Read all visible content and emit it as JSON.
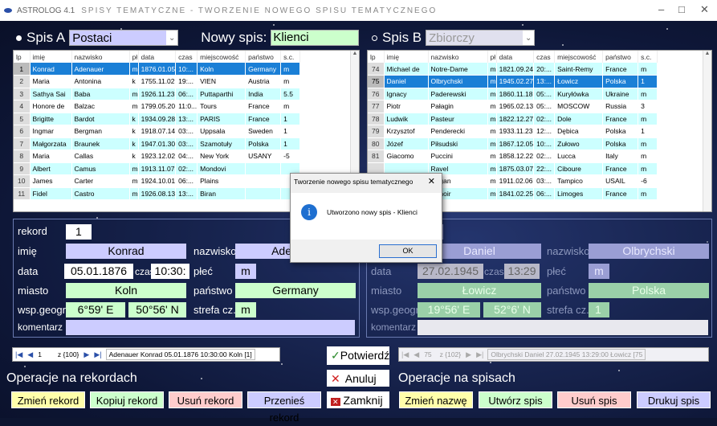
{
  "window": {
    "app": "ASTROLOG 4.1",
    "title": "SPISY TEMATYCZNE - TWORZENIE NOWEGO SPISU TEMATYCZNEGO",
    "minimize": "–",
    "maximize": "□",
    "close": "✕"
  },
  "listA": {
    "label": "Spis A",
    "value": "Postaci",
    "new_label": "Nowy spis:",
    "new_value": "Klienci"
  },
  "listB": {
    "label": "Spis B",
    "value": "Zbiorczy"
  },
  "columns": [
    "lp",
    "imię",
    "nazwisko",
    "pł",
    "data",
    "czas",
    "miejscowość",
    "państwo",
    "s.c."
  ],
  "gridA": [
    [
      "1",
      "Konrad",
      "Adenauer",
      "m",
      "1876.01.05",
      "10:...",
      "Koln",
      "Germany",
      "m"
    ],
    [
      "2",
      "Maria",
      "Antonina",
      "k",
      "1755.11.02",
      "19:...",
      "VIEN",
      "Austria",
      "m"
    ],
    [
      "3",
      "Sathya Sai",
      "Baba",
      "m",
      "1926.11.23",
      "06:...",
      "Puttaparthi",
      "India",
      "5.5"
    ],
    [
      "4",
      "Honore de",
      "Balzac",
      "m",
      "1799.05.20",
      "11:0...",
      "Tours",
      "France",
      "m"
    ],
    [
      "5",
      "Brigitte",
      "Bardot",
      "k",
      "1934.09.28",
      "13:...",
      "PARIS",
      "France",
      "1"
    ],
    [
      "6",
      "Ingmar",
      "Bergman",
      "k",
      "1918.07.14",
      "03:...",
      "Uppsala",
      "Sweden",
      "1"
    ],
    [
      "7",
      "Małgorzata",
      "Braunek",
      "k",
      "1947.01.30",
      "03:...",
      "Szamotuły",
      "Polska",
      "1"
    ],
    [
      "8",
      "Maria",
      "Callas",
      "k",
      "1923.12.02",
      "04:...",
      "New York",
      "USANY",
      "-5"
    ],
    [
      "9",
      "Albert",
      "Camus",
      "m",
      "1913.11.07",
      "02:...",
      "Mondovi",
      "",
      ""
    ],
    [
      "10",
      "James",
      "Carter",
      "m",
      "1924.10.01",
      "06:...",
      "Plains",
      "",
      ""
    ],
    [
      "11",
      "Fidel",
      "Castro",
      "m",
      "1926.08.13",
      "13:...",
      "Biran",
      "",
      ""
    ]
  ],
  "gridB": [
    [
      "74",
      "Michael de",
      "Notre-Dame",
      "m",
      "1821.09.24",
      "20:...",
      "Saint-Remy",
      "France",
      "m"
    ],
    [
      "75",
      "Daniel",
      "Olbrychski",
      "m",
      "1945.02.27",
      "13:...",
      "Łowicz",
      "Polska",
      "1"
    ],
    [
      "76",
      "Ignacy",
      "Paderewski",
      "m",
      "1860.11.18",
      "05:...",
      "Kuryłówka",
      "Ukraine",
      "m"
    ],
    [
      "77",
      "Piotr",
      "Pałagin",
      "m",
      "1965.02.13",
      "05:...",
      "MOSCOW",
      "Russia",
      "3"
    ],
    [
      "78",
      "Ludwik",
      "Pasteur",
      "m",
      "1822.12.27",
      "02:...",
      "Dole",
      "France",
      "m"
    ],
    [
      "79",
      "Krzysztof",
      "Penderecki",
      "m",
      "1933.11.23",
      "12:...",
      "Dębica",
      "Polska",
      "1"
    ],
    [
      "80",
      "Józef",
      "Piłsudski",
      "m",
      "1867.12.05",
      "10:...",
      "Zułowo",
      "Polska",
      "m"
    ],
    [
      "81",
      "Giacomo",
      "Puccini",
      "m",
      "1858.12.22",
      "02:...",
      "Lucca",
      "Italy",
      "m"
    ],
    [
      "",
      "",
      "Ravel",
      "m",
      "1875.03.07",
      "22:...",
      "Ciboure",
      "France",
      "m"
    ],
    [
      "",
      "",
      "Regan",
      "m",
      "1911.02.06",
      "03:...",
      "Tampico",
      "USAIL",
      "-6"
    ],
    [
      "",
      "",
      "Renoir",
      "m",
      "1841.02.25",
      "06:...",
      "Limoges",
      "France",
      "m"
    ]
  ],
  "recA": {
    "l_rekord": "rekord",
    "rekord": "1",
    "l_imie": "imię",
    "imie": "Konrad",
    "l_nazwisko": "nazwisko",
    "nazwisko": "Ade",
    "l_data": "data",
    "data": "05.01.1876",
    "l_czas": "czas",
    "czas": "10:30:",
    "l_plec": "płeć",
    "plec": "m",
    "l_miasto": "miasto",
    "miasto": "Koln",
    "l_panstwo": "państwo",
    "panstwo": "Germany",
    "l_wsp": "wsp.geogr.",
    "lon": "6°59' E",
    "lat": "50°56' N",
    "l_strefa": "strefa cz.",
    "strefa": "m",
    "l_kom": "komentarz"
  },
  "recB": {
    "imie": "Daniel",
    "l_nazwisko": "nazwisko",
    "nazwisko": "Olbrychski",
    "l_data": "data",
    "data": "27.02.1945",
    "l_czas": "czas",
    "czas": "13:29",
    "l_plec": "płeć",
    "plec": "m",
    "l_miasto": "miasto",
    "miasto": "Łowicz",
    "l_panstwo": "państwo",
    "panstwo": "Polska",
    "l_wsp": "wsp.geogr.",
    "lon": "19°56' E",
    "lat": "52°6' N",
    "l_strefa": "strefa cz.",
    "strefa": "1",
    "l_kom": "komentarz"
  },
  "navA": {
    "pos": "1",
    "count": "z {100}",
    "combo": "Adenauer  Konrad  05.01.1876  10:30:00  Koln  [1]"
  },
  "navB": {
    "pos": "75",
    "count": "z {102}",
    "combo": "Olbrychski  Daniel  27.02.1945  13:29:00  Łowicz  [75"
  },
  "ops_records": {
    "title": "Operacje na rekordach",
    "change": "Zmień rekord",
    "copy": "Kopiuj rekord",
    "delete": "Usuń rekord",
    "move": "Przenieś rekord"
  },
  "center_buttons": {
    "confirm": "Potwierdź",
    "cancel": "Anuluj",
    "close": "Zamknij"
  },
  "ops_lists": {
    "title": "Operacje na spisach",
    "rename": "Zmień nazwę",
    "create": "Utwórz spis",
    "delete": "Usuń spis",
    "print": "Drukuj spis"
  },
  "dialog": {
    "title": "Tworzenie nowego spisu tematycznego",
    "message": "Utworzono nowy spis - Klienci",
    "ok": "OK"
  }
}
